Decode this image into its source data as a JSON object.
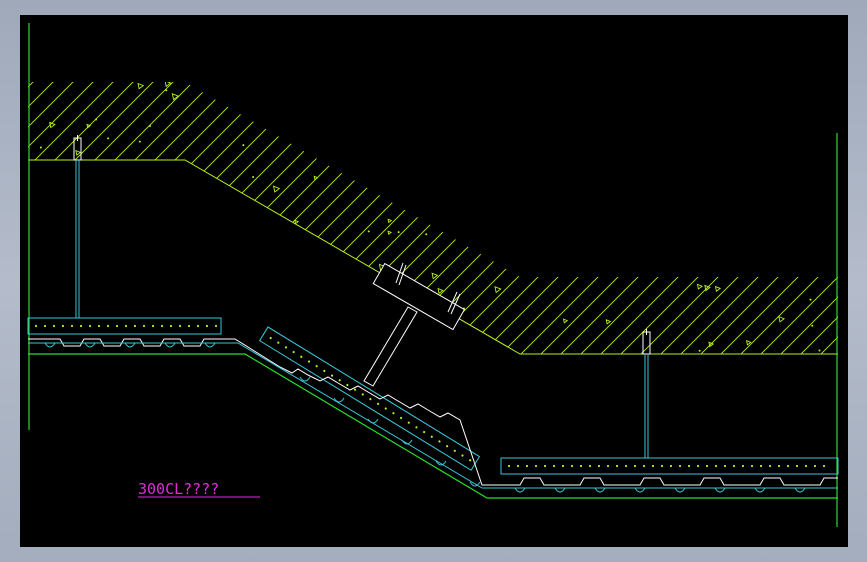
{
  "drawing": {
    "annotation": "300CL????",
    "colors": {
      "background": "#000000",
      "soil": "#b7f21c",
      "panel": "#39c9d8",
      "profile": "#2bdc2b",
      "rod": "#39c9d8",
      "strut": "#ffffff",
      "annotation": "#e02cd6"
    }
  }
}
